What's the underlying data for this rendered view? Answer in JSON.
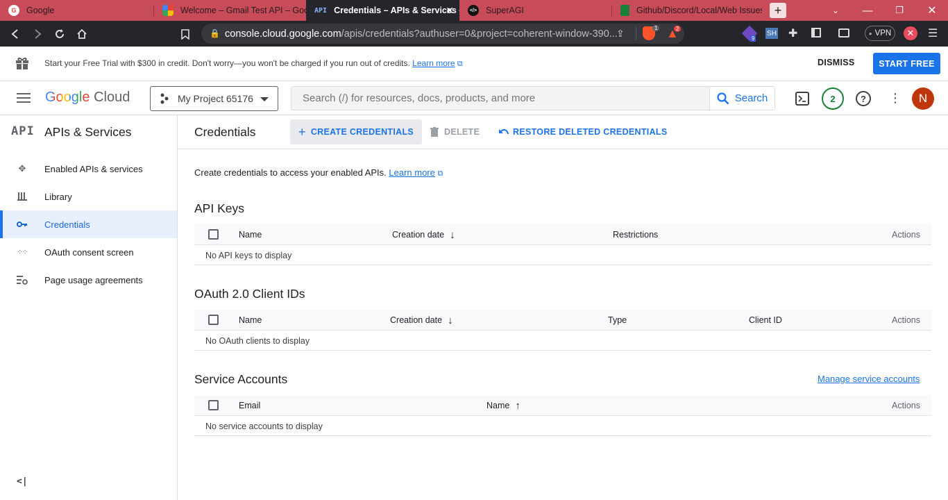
{
  "browser": {
    "tabs": [
      {
        "label": "Google",
        "icon": "google-icon"
      },
      {
        "label": "Welcome – Gmail Test API – Goog",
        "icon": "cloud-icon"
      },
      {
        "label": "Credentials – APIs & Services –",
        "icon": "api-icon",
        "favicon_text": "API"
      },
      {
        "label": "SuperAGI",
        "icon": "superagi-icon",
        "favicon_text": "</>"
      },
      {
        "label": "Github/Discord/Local/Web Issues",
        "icon": "sheets-icon"
      }
    ],
    "url_host": "console.cloud.google.com",
    "url_path": "/apis/credentials?authuser=0&project=coherent-window-390...",
    "badges": {
      "shield": "1",
      "rewards": "2",
      "ext": "9",
      "sh": "SH"
    },
    "vpn_label": "VPN"
  },
  "promo": {
    "text": "Start your Free Trial with $300 in credit. Don't worry—you won't be charged if you run out of credits.",
    "link": "Learn more",
    "dismiss": "DISMISS",
    "start": "START FREE"
  },
  "header": {
    "logo_google": "Google",
    "logo_cloud": "Cloud",
    "project": "My Project 65176",
    "search_placeholder": "Search (/) for resources, docs, products, and more",
    "search_button": "Search",
    "notif_count": "2",
    "avatar": "N"
  },
  "sidebar": {
    "badge": "API",
    "title": "APIs & Services",
    "items": [
      {
        "label": "Enabled APIs & services"
      },
      {
        "label": "Library"
      },
      {
        "label": "Credentials"
      },
      {
        "label": "OAuth consent screen"
      },
      {
        "label": "Page usage agreements"
      }
    ],
    "collapse": "<|"
  },
  "main": {
    "title": "Credentials",
    "create": "CREATE CREDENTIALS",
    "delete": "DELETE",
    "restore": "RESTORE DELETED CREDENTIALS",
    "intro": "Create credentials to access your enabled APIs.",
    "intro_link": "Learn more",
    "api_keys": {
      "title": "API Keys",
      "cols": [
        "Name",
        "Creation date",
        "Restrictions",
        "Actions"
      ],
      "empty": "No API keys to display"
    },
    "oauth": {
      "title": "OAuth 2.0 Client IDs",
      "cols": [
        "Name",
        "Creation date",
        "Type",
        "Client ID",
        "Actions"
      ],
      "empty": "No OAuth clients to display"
    },
    "service": {
      "title": "Service Accounts",
      "manage": "Manage service accounts",
      "cols": [
        "Email",
        "Name",
        "Actions"
      ],
      "empty": "No service accounts to display"
    }
  },
  "colors": {
    "accent": "#1a73e8",
    "tabbar": "#c74b58",
    "active_nav_bg": "#e8f0fe"
  }
}
